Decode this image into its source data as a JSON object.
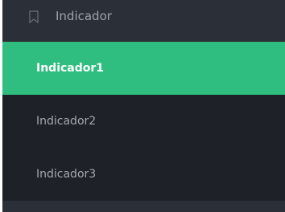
{
  "menu": {
    "header": {
      "icon": "bookmark-icon",
      "label": "Indicador"
    },
    "items": [
      {
        "label": "Indicador1",
        "active": true
      },
      {
        "label": "Indicador2",
        "active": false
      },
      {
        "label": "Indicador3",
        "active": false
      }
    ]
  },
  "colors": {
    "header_bg": "#2b2f37",
    "submenu_bg": "#1e2128",
    "active_bg": "#2fbe7f",
    "active_text": "#ffffff",
    "inactive_text": "#a3a8b0"
  }
}
